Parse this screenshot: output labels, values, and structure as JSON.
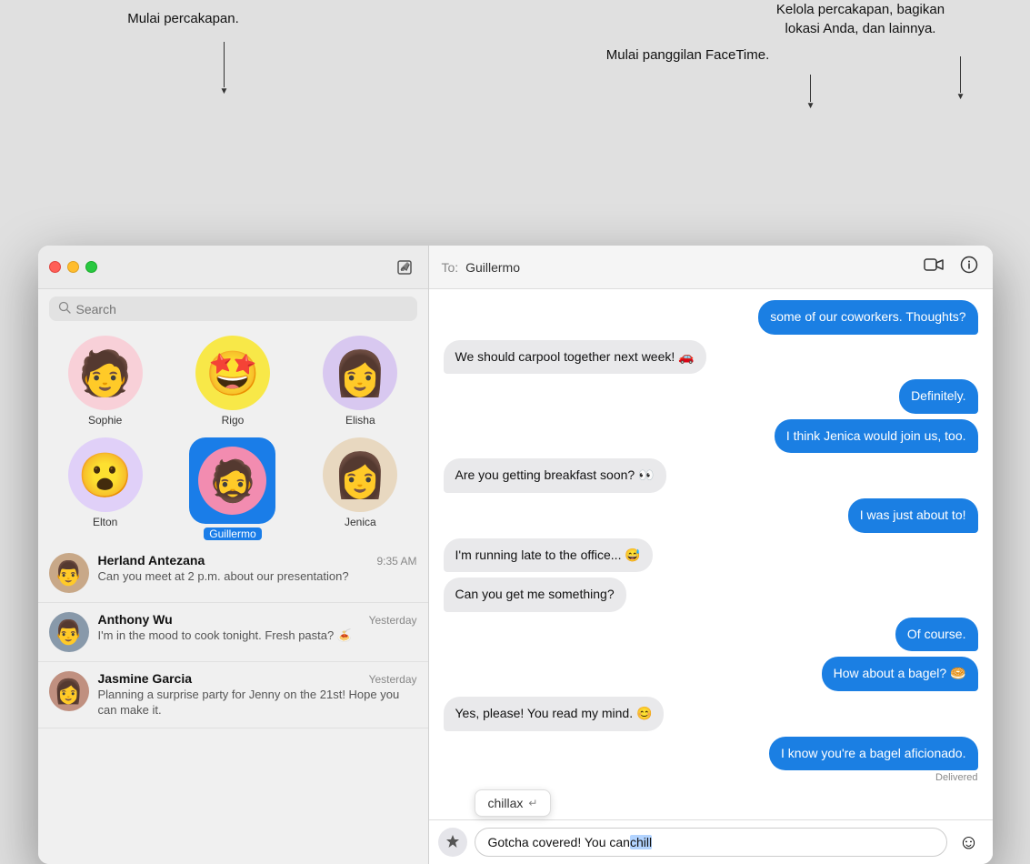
{
  "annotations": {
    "start_convo": "Mulai percakapan.",
    "facetime": "Mulai panggilan FaceTime.",
    "manage": "Kelola percakapan, bagikan\nlokasi Anda, dan lainnya."
  },
  "titlebar": {
    "compose_label": "✏"
  },
  "search": {
    "placeholder": "Search"
  },
  "pinned_contacts": [
    {
      "name": "Sophie",
      "emoji": "🧑‍🎤",
      "bg": "#f8d0d8",
      "selected": false
    },
    {
      "name": "Rigo",
      "emoji": "🤩",
      "bg": "#f8e848",
      "selected": false
    },
    {
      "name": "Elisha",
      "emoji": "👩‍🦱",
      "bg": "#d8c8f0",
      "selected": false
    }
  ],
  "pinned_contacts_row2": [
    {
      "name": "Elton",
      "emoji": "😮",
      "bg": "#e0d0f8",
      "selected": false
    },
    {
      "name": "Guillermo",
      "emoji": "🧔",
      "bg": "#f28cb0",
      "selected": true
    },
    {
      "name": "Jenica",
      "emoji": "👩‍🦰",
      "bg": "#e8d8c0",
      "selected": false
    }
  ],
  "conversations": [
    {
      "name": "Herland Antezana",
      "time": "9:35 AM",
      "preview": "Can you meet at 2 p.m. about our presentation?",
      "emoji": "👨",
      "bg": "#c8a888"
    },
    {
      "name": "Anthony Wu",
      "time": "Yesterday",
      "preview": "I'm in the mood to cook tonight. Fresh pasta? 🍝",
      "emoji": "👨",
      "bg": "#8899aa"
    },
    {
      "name": "Jasmine Garcia",
      "time": "Yesterday",
      "preview": "Planning a surprise party for Jenny on the 21st! Hope you can make it.",
      "emoji": "👩",
      "bg": "#c09080"
    }
  ],
  "chat": {
    "to_label": "To:",
    "recipient": "Guillermo",
    "messages": [
      {
        "side": "sent",
        "text": "some of our coworkers. Thoughts?"
      },
      {
        "side": "received",
        "text": "We should carpool together next week! 🚗"
      },
      {
        "side": "sent",
        "text": "Definitely."
      },
      {
        "side": "sent",
        "text": "I think Jenica would join us, too."
      },
      {
        "side": "received",
        "text": "Are you getting breakfast soon? 👀"
      },
      {
        "side": "sent",
        "text": "I was just about to!"
      },
      {
        "side": "received",
        "text": "I'm running late to the office... 😅"
      },
      {
        "side": "received",
        "text": "Can you get me something?"
      },
      {
        "side": "sent",
        "text": "Of course."
      },
      {
        "side": "sent",
        "text": "How about a bagel? 🥯"
      },
      {
        "side": "received",
        "text": "Yes, please! You read my mind. 😊"
      },
      {
        "side": "sent",
        "text": "I know you're a bagel aficionado.",
        "delivered": true
      }
    ],
    "input_value": "Gotcha covered! You can chill",
    "input_highlighted": "chill",
    "autocomplete_word": "chillax",
    "autocomplete_icon": "↵",
    "delivered_label": "Delivered"
  }
}
